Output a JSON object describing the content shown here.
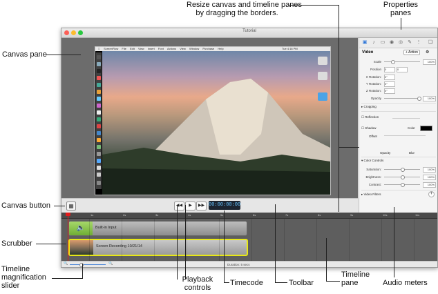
{
  "window": {
    "title": "Tutorial"
  },
  "colors": {
    "accent": "#2a74d8",
    "timecode_text": "#66c2ff",
    "selection_outline": "#e8e817",
    "playhead": "#e21b1b"
  },
  "recording_menubar": {
    "items": [
      "ScreenFlow",
      "File",
      "Edit",
      "View",
      "Insert",
      "Font",
      "Actions",
      "View",
      "Window",
      "Purchase",
      "Help"
    ],
    "clock": "Tue 4:16 PM"
  },
  "canvas_toolbar": {
    "canvas_button_icon": "crop-icon",
    "rewind_icon": "rewind-icon",
    "play_icon": "play-icon",
    "forward_icon": "fast-forward-icon",
    "timecode": "00:00:00:00"
  },
  "properties": {
    "tabs": [
      "video-icon",
      "audio-icon",
      "screen-recording-icon",
      "callout-icon",
      "annotation-icon",
      "touch-icon",
      "text-icon",
      "library-icon"
    ],
    "section": "Video",
    "action_label": "+ Action",
    "rows": [
      {
        "label": "Scale",
        "value": "100%"
      },
      {
        "label": "Position",
        "value": "0"
      },
      {
        "label": "X Rotation:",
        "value": "0°"
      },
      {
        "label": "Y Rotation:",
        "value": "0°"
      },
      {
        "label": "Z Rotation:",
        "value": "0°"
      },
      {
        "label": "Opacity",
        "value": "100%"
      }
    ],
    "cropping": "Cropping",
    "reflection": "Reflection",
    "shadow": "Shadow",
    "color": "Color",
    "offset": "Offset",
    "opacity_blur": [
      "Opacity",
      "Blur"
    ],
    "color_controls": "Color Controls",
    "color_rows": [
      {
        "label": "Saturation:",
        "value": "100%"
      },
      {
        "label": "Brightness:",
        "value": "100%"
      },
      {
        "label": "Contrast:",
        "value": "100%"
      }
    ],
    "video_filters": "Video Filters"
  },
  "timeline": {
    "ruler": [
      "1s",
      "2s",
      "3s",
      "4s",
      "5s",
      "6s",
      "7s",
      "8s",
      "9s",
      "10s",
      "11s"
    ],
    "clips": [
      {
        "label": "Built-in Input",
        "kind": "audio"
      },
      {
        "label": "Screen Recording 10/21/14",
        "kind": "video"
      }
    ],
    "duration": "Duration: 5 secs"
  },
  "callouts": {
    "canvas_pane": "Canvas pane",
    "resize": [
      "Resize canvas and timeline panes",
      "by dragging the borders."
    ],
    "properties": [
      "Properties",
      "panes"
    ],
    "canvas_button": "Canvas button",
    "scrubber": "Scrubber",
    "magnification": [
      "Timeline",
      "magnification",
      "slider"
    ],
    "playback": [
      "Playback",
      "controls"
    ],
    "timecode": "Timecode",
    "toolbar": "Toolbar",
    "timeline_pane": [
      "Timeline",
      "pane"
    ],
    "audio_meters": "Audio meters"
  }
}
